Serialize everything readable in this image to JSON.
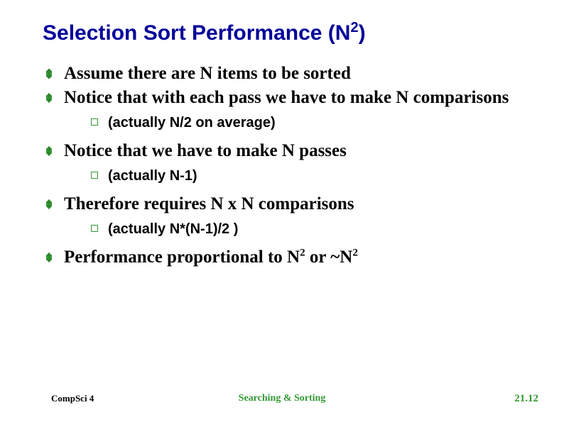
{
  "title_prefix": "Selection Sort Performance (N",
  "title_sup": "2",
  "title_suffix": ")",
  "bullets": {
    "b1": "Assume there are N items to be sorted",
    "b2": "Notice that with each pass we have to make N comparisons",
    "b2_sub": "(actually N/2 on average)",
    "b3": "Notice that we have to make N passes",
    "b3_sub": "(actually N-1)",
    "b4": "Therefore requires N x N comparisons",
    "b4_sub": "(actually N*(N-1)/2 )",
    "b5_prefix": "Performance proportional to N",
    "b5_sup1": "2",
    "b5_mid": "  or  ~N",
    "b5_sup2": "2"
  },
  "footer": {
    "left": "CompSci 4",
    "center": "Searching & Sorting",
    "right": "21.12"
  }
}
